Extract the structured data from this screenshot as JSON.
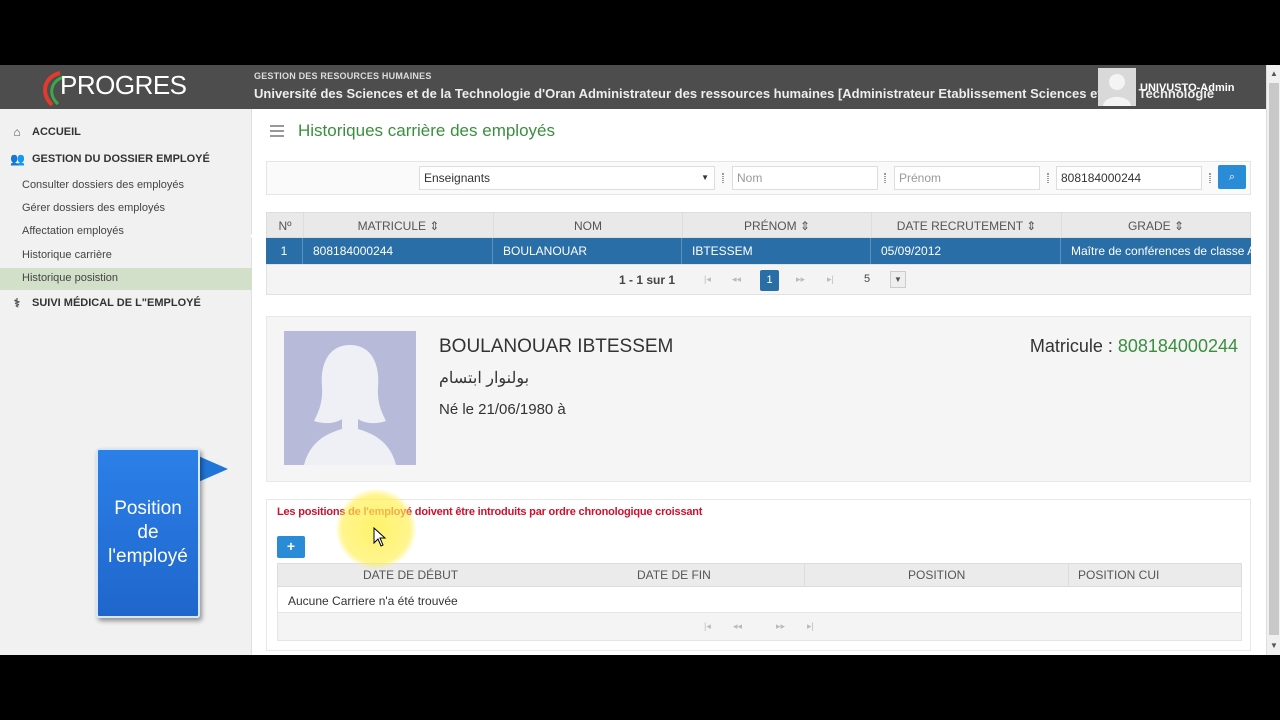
{
  "header": {
    "logo_text": "PROGRES",
    "subtitle": "GESTION DES RESOURCES HUMAINES",
    "title": "Université des Sciences et de la Technologie d'Oran Administrateur des ressources humaines [Administrateur Etablissement Sciences et de la Technologie",
    "user_name": "UNIVUSTO-Admin"
  },
  "sidebar": {
    "home": "ACCUEIL",
    "section": "GESTION DU DOSSIER EMPLOYÉ",
    "items": [
      {
        "label": "Consulter dossiers des employés"
      },
      {
        "label": "Gérer dossiers des employés"
      },
      {
        "label": "Affectation employés"
      },
      {
        "label": "Historique carrière"
      },
      {
        "label": "Historique posistion"
      }
    ],
    "medical": "SUIVI MÉDICAL DE L\"EMPLOYÉ"
  },
  "callout": {
    "line1": "Position",
    "line2": "de",
    "line3": "l'employé"
  },
  "page": {
    "title": "Historiques carrière des employés"
  },
  "filters": {
    "category": "Enseignants",
    "nom_placeholder": "Nom",
    "prenom_placeholder": "Prénom",
    "matricule_value": "808184000244"
  },
  "table": {
    "headers": [
      "Nº",
      "MATRICULE ⇕",
      "NOM",
      "PRÉNOM ⇕",
      "DATE RECRUTEMENT ⇕",
      "GRADE ⇕"
    ],
    "row": {
      "n": "1",
      "matricule": "808184000244",
      "nom": "BOULANOUAR",
      "prenom": "IBTESSEM",
      "date": "05/09/2012",
      "grade": "Maître de conférences de classe A"
    },
    "pager_text": "1 - 1 sur 1",
    "current_page": "1",
    "page_size": "5"
  },
  "profile": {
    "name": "BOULANOUAR IBTESSEM",
    "arabic": "بولنوار ابتسام",
    "born": "Né le 21/06/1980 à",
    "matricule_label": "Matricule : ",
    "matricule_value": "808184000244"
  },
  "positions": {
    "warning": "Les positions de l'employé doivent être introduits par ordre chronologique croissant",
    "add_label": "+",
    "headers": [
      "DATE DE DÉBUT",
      "DATE DE FIN",
      "POSITION",
      "POSITION CUI"
    ],
    "empty": "Aucune Carriere n'a été trouvée"
  },
  "colors": {
    "accent_green": "#3a8f3e",
    "selected_row": "#2a6ea7",
    "warning": "#d0102b",
    "button_blue": "#2a8bd6"
  }
}
